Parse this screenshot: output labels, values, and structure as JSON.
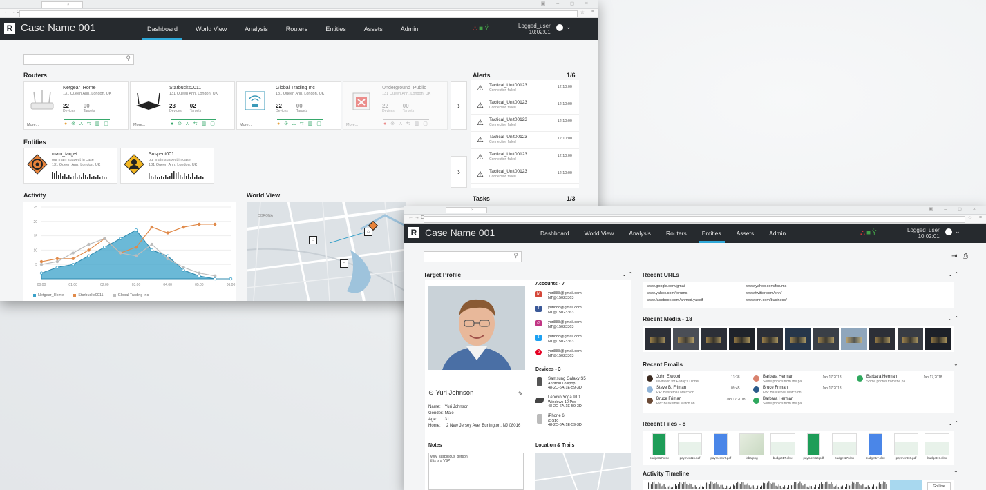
{
  "app": {
    "case_name": "Case Name 001",
    "logo_letter": "R"
  },
  "nav": {
    "tabs": [
      "Dashboard",
      "World View",
      "Analysis",
      "Routers",
      "Entities",
      "Assets",
      "Admin"
    ]
  },
  "user": {
    "name": "Logged_user",
    "time": "10:02:01"
  },
  "dashboard": {
    "sections": {
      "routers": "Routers",
      "entities": "Entities",
      "activity": "Activity",
      "world_view": "World View",
      "alerts": "Alerts",
      "tasks": "Tasks"
    },
    "alerts_count": "1/6",
    "tasks_count": "1/3",
    "routers": [
      {
        "name": "Netgear_Home",
        "address": "131 Queen Ann, London, UK",
        "devices": "22",
        "targets": "00",
        "more": "More..."
      },
      {
        "name": "Starbucks0011",
        "address": "131 Queen Ann, London, UK",
        "devices": "23",
        "targets": "02",
        "more": "More..."
      },
      {
        "name": "Global Trading Inc",
        "address": "131 Queen Ann, London, UK",
        "devices": "22",
        "targets": "00",
        "more": "More..."
      },
      {
        "name": "Underground_Public",
        "address": "131 Queen Ann, London, UK",
        "devices": "22",
        "targets": "00",
        "more": "More..."
      }
    ],
    "stat_labels": {
      "devices": "Devices",
      "targets": "Targets"
    },
    "entities": [
      {
        "name": "main_target",
        "desc": "our main suspect in case",
        "address": "131 Queen Ann, London, UK"
      },
      {
        "name": "Suspect001",
        "desc": "our main suspect in case",
        "address": "131 Queen Ann, London, UK"
      }
    ],
    "alerts": [
      {
        "title": "Tactical_Unit00123",
        "sub": "Connection failed",
        "time": "12:10:00"
      },
      {
        "title": "Tactical_Unit00123",
        "sub": "Connection failed",
        "time": "12:10:00"
      },
      {
        "title": "Tactical_Unit00123",
        "sub": "Connection failed",
        "time": "12:10:00"
      },
      {
        "title": "Tactical_Unit00123",
        "sub": "Connection failed",
        "time": "12:10:00"
      },
      {
        "title": "Tactical_Unit00123",
        "sub": "Connection failed",
        "time": "12:10:00"
      },
      {
        "title": "Tactical_Unit00123",
        "sub": "Connection failed",
        "time": "12:10:00"
      }
    ],
    "legend": [
      "Netgear_Home",
      "Starbucks0011",
      "Global Trading Inc"
    ],
    "map_label": "CORONA"
  },
  "chart_data": {
    "type": "area",
    "categories": [
      "00:00",
      "01:00",
      "02:00",
      "03:00",
      "04:00",
      "05:00",
      "06:00"
    ],
    "ylim": [
      0,
      25
    ],
    "yticks": [
      5,
      10,
      15,
      20,
      25
    ],
    "series": [
      {
        "name": "Netgear_Home",
        "x": [
          0,
          0.5,
          1,
          1.5,
          2,
          2.5,
          3,
          3.5,
          4,
          4.5,
          5,
          5.5,
          6
        ],
        "values": [
          2,
          4,
          5,
          8,
          11,
          14,
          17,
          10,
          8,
          3,
          1,
          0,
          0
        ],
        "color": "#3aa1c9"
      },
      {
        "name": "Starbucks0011",
        "x": [
          0,
          0.5,
          1,
          1.5,
          2,
          2.5,
          3,
          3.5,
          4,
          4.5,
          5,
          5.5,
          6
        ],
        "values": [
          6,
          7,
          7,
          10,
          14,
          9,
          11,
          18,
          16,
          18,
          19,
          19,
          null
        ],
        "color": "#e08a4a"
      },
      {
        "name": "Global Trading Inc",
        "x": [
          0,
          0.5,
          1,
          1.5,
          2,
          2.5,
          3,
          3.5,
          4,
          4.5,
          5,
          5.5,
          6
        ],
        "values": [
          5,
          6,
          9,
          12,
          14,
          9,
          8,
          12,
          7,
          4,
          2,
          1,
          null
        ],
        "color": "#bdbdbd"
      }
    ]
  },
  "profile": {
    "sections": {
      "target_profile": "Target Profile",
      "accounts": "Accounts - 7",
      "devices": "Devices - 3",
      "notes": "Notes",
      "location": "Location & Trails"
    },
    "name": "Yuri Johnson",
    "details": [
      {
        "k": "Name:",
        "v": "Yuri Johnson"
      },
      {
        "k": "Gender:",
        "v": "Male"
      },
      {
        "k": "Age:",
        "v": "31"
      },
      {
        "k": "Home:",
        "v": "2 New Jersey Ave, Burlington, NJ 08016"
      }
    ],
    "accounts": [
      {
        "email": "yuri888@gmail.com",
        "id": "NT@15023363",
        "icon": "gmail-icon",
        "color": "#d44638"
      },
      {
        "email": "yuri888@gmail.com",
        "id": "NT@15023363",
        "icon": "facebook-icon",
        "color": "#3b5998"
      },
      {
        "email": "yuri888@gmail.com",
        "id": "NT@15023363",
        "icon": "instagram-icon",
        "color": "#c13584"
      },
      {
        "email": "yuri888@gmail.com",
        "id": "NT@15023363",
        "icon": "twitter-icon",
        "color": "#1da1f2"
      },
      {
        "email": "yuri888@gmail.com",
        "id": "NT@15023363",
        "icon": "pinterest-icon",
        "color": "#e60023"
      }
    ],
    "devices": [
      {
        "name": "Samsung Galaxy S5",
        "os": "Android Lollipop",
        "mac": "48-2C-6A-1E-59-3D"
      },
      {
        "name": "Lenovo Yoga 910",
        "os": "Windows 10 Pro",
        "mac": "48-2C-6A-1E-59-3D"
      },
      {
        "name": "iPhone 6",
        "os": "iOS10",
        "mac": "48-2C-6A-1E-59-3D"
      }
    ],
    "notes": "very_suspicious_person\nthis is a VSP"
  },
  "right": {
    "recent_urls": "Recent URLs",
    "urls": [
      "www.google.com/gmail",
      "www.yahoo.com/forums",
      "www.facebook.com/ahmed.yassif",
      "www.yahoo.com/forums",
      "www.twitter.com/cnn/",
      "www.cnn.com/business/"
    ],
    "recent_media": "Recent Media - 18",
    "recent_emails": "Recent Emails",
    "emails": [
      {
        "name": "John Elwood",
        "subject": "Invitation for Friday's Dinner",
        "date": "13:38"
      },
      {
        "name": "Steve B. Friman",
        "subject": "RE: Basketball Match on...",
        "date": "09:45"
      },
      {
        "name": "Bruce Friman",
        "subject": "FW: Basketball Match on...",
        "date": "Jan 17,2018"
      },
      {
        "name": "Barbara Herman",
        "subject": "Some photos from the pa...",
        "date": "Jan 17,2018"
      },
      {
        "name": "Bruce Friman",
        "subject": "FW: Basketball Match on...",
        "date": "Jan 17,2018"
      },
      {
        "name": "Barbara Herman",
        "subject": "Some photos from the pa...",
        "date": "Jan 17,2018"
      },
      {
        "name": "Barbara Herman",
        "subject": "Some photos from the pa...",
        "date": "Jan 17,2018"
      }
    ],
    "recent_files": "Recent Files - 8",
    "files": [
      "budget17.xlsx",
      "payment16.pdf",
      "payment17.pdf",
      "loba.png",
      "budget17.xlsx",
      "payment16.pdf",
      "budget17.xlsx",
      "budget17.xlsx",
      "payment16.pdf",
      "budget17.xlsx"
    ],
    "activity_timeline": "Activity Timeline",
    "go_live": "Go Live"
  }
}
